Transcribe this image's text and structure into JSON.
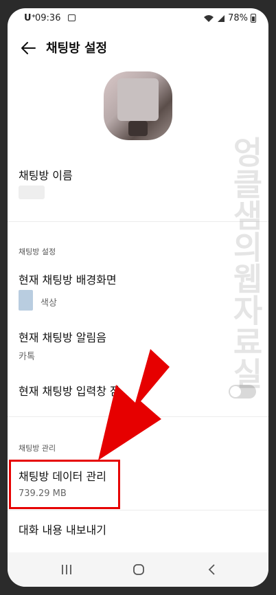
{
  "status_bar": {
    "carrier": "U⁺",
    "time": "09:36",
    "battery": "78%"
  },
  "header": {
    "title": "채팅방 설정"
  },
  "chat_name": {
    "label": "채팅방 이름"
  },
  "settings_section": {
    "heading": "채팅방 설정",
    "background": {
      "label": "현재 채팅방 배경화면",
      "value": "색상"
    },
    "notification": {
      "label": "현재 채팅방 알림음",
      "value": "카톡"
    },
    "input_window": {
      "label": "현재 채팅방 입력창 잠"
    }
  },
  "management_section": {
    "heading": "채팅방 관리",
    "data_management": {
      "label": "채팅방 데이터 관리",
      "value": "739.29 MB"
    },
    "export": {
      "label": "대화 내용 내보내기"
    }
  },
  "watermark": "엉클샘의웹자료실",
  "colors": {
    "highlight": "#e60000",
    "swatch": "#b9cde0"
  }
}
